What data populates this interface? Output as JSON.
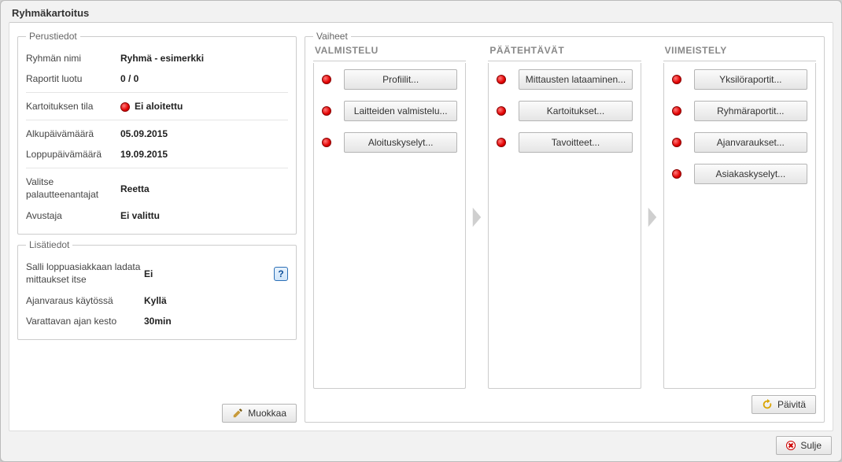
{
  "window": {
    "title": "Ryhmäkartoitus"
  },
  "basics": {
    "legend": "Perustiedot",
    "group_name_label": "Ryhmän nimi",
    "group_name_value": "Ryhmä - esimerkki",
    "reports_created_label": "Raportit luotu",
    "reports_created_value": "0 / 0",
    "status_label": "Kartoituksen tila",
    "status_value": "Ei aloitettu",
    "start_date_label": "Alkupäivämäärä",
    "start_date_value": "05.09.2015",
    "end_date_label": "Loppupäivämäärä",
    "end_date_value": "19.09.2015",
    "feedback_givers_label": "Valitse palautteenantajat",
    "feedback_givers_value": "Reetta",
    "assistant_label": "Avustaja",
    "assistant_value": "Ei valittu"
  },
  "extra": {
    "legend": "Lisätiedot",
    "allow_self_upload_label": "Salli loppuasiakkaan ladata mittaukset itse",
    "allow_self_upload_value": "Ei",
    "booking_enabled_label": "Ajanvaraus käytössä",
    "booking_enabled_value": "Kyllä",
    "booking_duration_label": "Varattavan ajan kesto",
    "booking_duration_value": "30min"
  },
  "phases": {
    "legend": "Vaiheet",
    "prep": {
      "title": "VALMISTELU",
      "tasks": [
        "Profiilit...",
        "Laitteiden valmistelu...",
        "Aloituskyselyt..."
      ]
    },
    "main": {
      "title": "PÄÄTEHTÄVÄT",
      "tasks": [
        "Mittausten lataaminen...",
        "Kartoitukset...",
        "Tavoitteet..."
      ]
    },
    "final": {
      "title": "VIIMEISTELY",
      "tasks": [
        "Yksilöraportit...",
        "Ryhmäraportit...",
        "Ajanvaraukset...",
        "Asiakaskyselyt..."
      ]
    }
  },
  "buttons": {
    "edit": "Muokkaa",
    "refresh": "Päivitä",
    "close": "Sulje"
  },
  "help_glyph": "?"
}
